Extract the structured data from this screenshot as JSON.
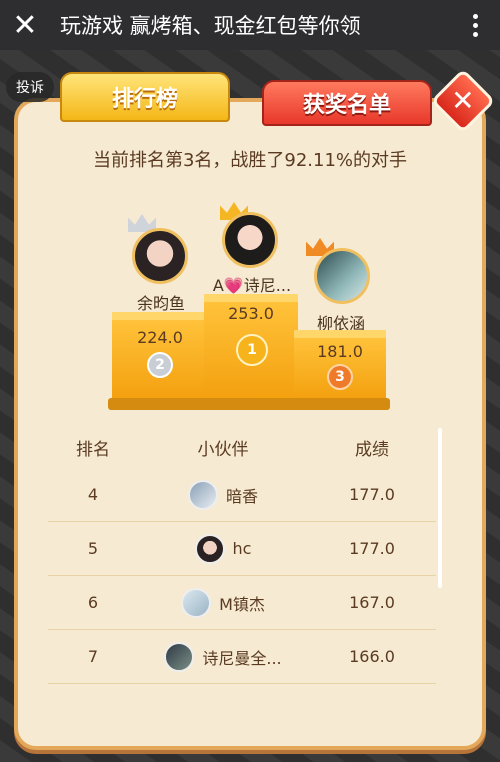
{
  "topbar": {
    "title": "玩游戏 赢烤箱、现金红包等你领",
    "close_icon": "close-icon",
    "more_icon": "more-dots-icon"
  },
  "report_label": "投诉",
  "tabs": {
    "rank": "排行榜",
    "winners": "获奖名单"
  },
  "summary": "当前排名第3名，战胜了92.11%的对手",
  "podium": {
    "first": {
      "name": "A💗诗尼...",
      "score": "253.0",
      "medal": "1"
    },
    "second": {
      "name": "余昀鱼",
      "score": "224.0",
      "medal": "2"
    },
    "third": {
      "name": "柳依涵",
      "score": "181.0",
      "medal": "3"
    }
  },
  "table": {
    "headers": {
      "rank": "排名",
      "name": "小伙伴",
      "score": "成绩"
    },
    "rows": [
      {
        "rank": "4",
        "name": "暗香",
        "score": "177.0"
      },
      {
        "rank": "5",
        "name": "hc",
        "score": "177.0"
      },
      {
        "rank": "6",
        "name": "M镇杰",
        "score": "167.0"
      },
      {
        "rank": "7",
        "name": "诗尼曼全...",
        "score": "166.0"
      }
    ]
  },
  "colors": {
    "panel": "#f6ead2",
    "gold": "#f4b717",
    "red": "#e8382b"
  }
}
